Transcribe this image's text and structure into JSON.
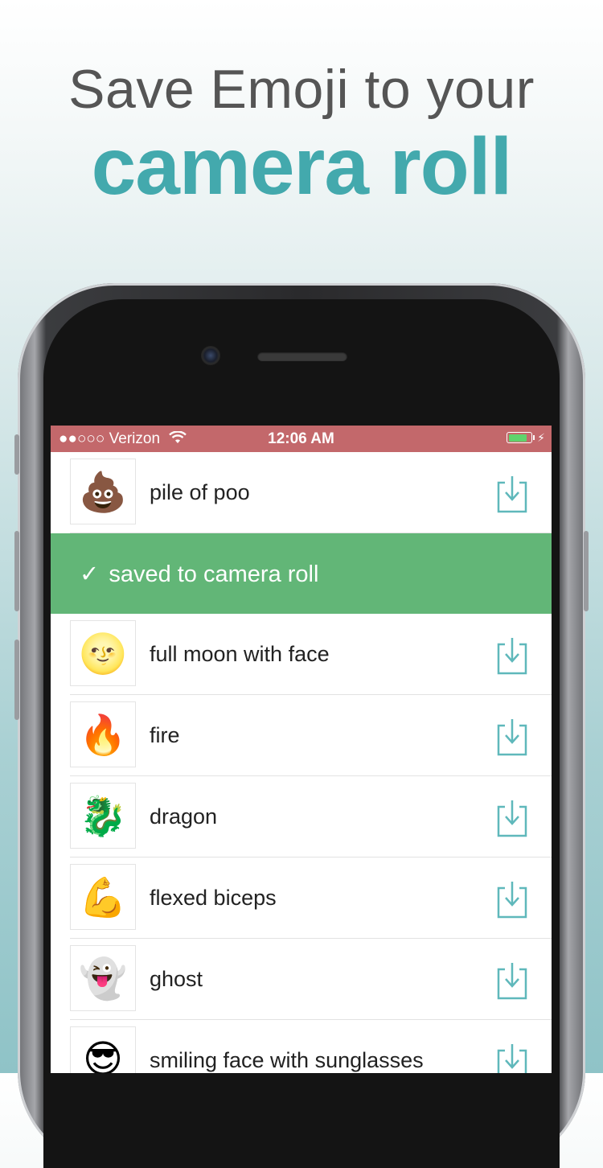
{
  "headline": {
    "line1": "Save Emoji to your",
    "line2": "camera roll",
    "accent_color": "#43a9ad"
  },
  "status_bar": {
    "carrier": "●●○○○ Verizon",
    "wifi_icon": "wifi-icon",
    "time": "12:06 AM",
    "battery_icon": "battery-icon",
    "background": "#c3686b"
  },
  "list": {
    "items": [
      {
        "emoji": "💩",
        "label": "pile of poo"
      },
      {
        "emoji": "🌝",
        "label": "full moon with face"
      },
      {
        "emoji": "🔥",
        "label": "fire"
      },
      {
        "emoji": "🐉",
        "label": "dragon"
      },
      {
        "emoji": "💪",
        "label": "flexed biceps"
      },
      {
        "emoji": "👻",
        "label": "ghost"
      },
      {
        "emoji": "😎",
        "label": "smiling face with sunglasses"
      }
    ],
    "toast": {
      "check": "✓",
      "text": "saved to camera roll",
      "color": "#62b677"
    },
    "download_icon": "download-icon"
  }
}
